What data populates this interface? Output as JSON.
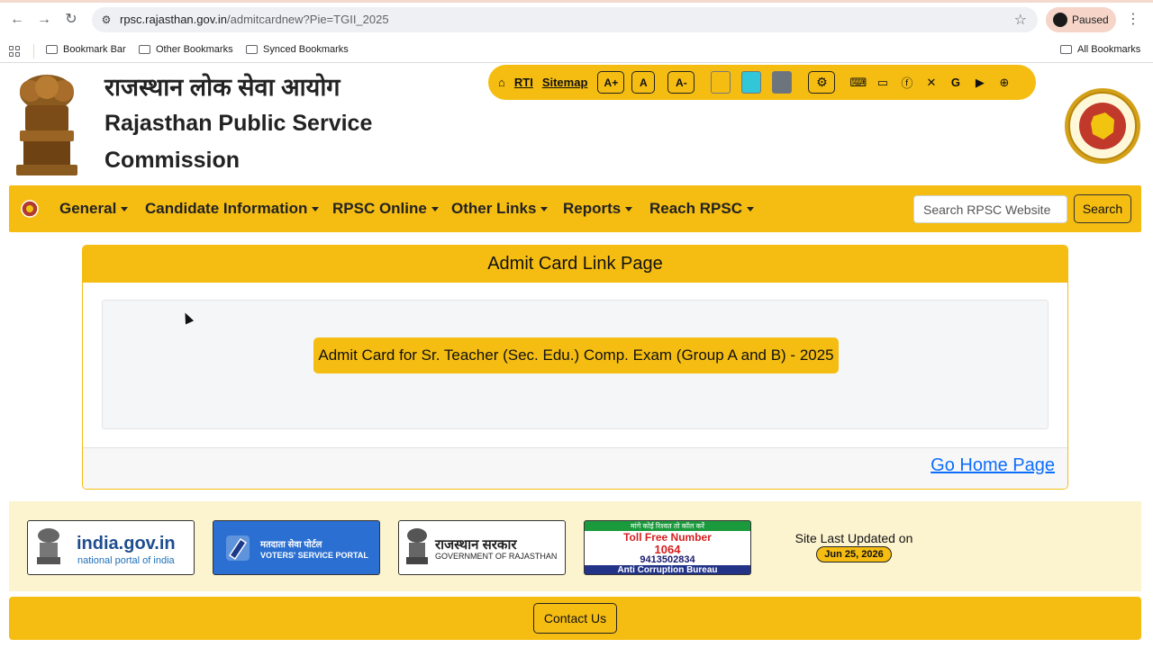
{
  "browser": {
    "url_host": "rpsc.rajasthan.gov.in",
    "url_path": "/admitcardnew?Pie=TGII_2025",
    "profile_status": "Paused",
    "bookmarks": [
      "Bookmark Bar",
      "Other Bookmarks",
      "Synced Bookmarks"
    ],
    "all_bookmarks": "All Bookmarks"
  },
  "header": {
    "title_hindi": "राजस्थान लोक सेवा आयोग",
    "title_english_line1": "Rajasthan Public Service",
    "title_english_line2": "Commission"
  },
  "topbar": {
    "rti": "RTI",
    "sitemap": "Sitemap",
    "font_plus": "A+",
    "font_normal": "A",
    "font_minus": "A-",
    "swatches": [
      "#f5bd12",
      "#31c6d8",
      "#6c757d"
    ]
  },
  "nav": {
    "items": [
      "General",
      "Candidate Information",
      "RPSC Online",
      "Other Links",
      "Reports",
      "Reach RPSC"
    ],
    "search_placeholder": "Search RPSC Website",
    "search_button": "Search"
  },
  "card": {
    "title": "Admit Card Link Page",
    "admit_link": "Admit Card for Sr. Teacher (Sec. Edu.) Comp. Exam (Group A and B) - 2025",
    "go_home": "Go Home Page"
  },
  "footer": {
    "india_gov_big": "india.gov.in",
    "india_gov_small": "national portal of india",
    "voters_hi": "मतदाता सेवा पोर्टल",
    "voters_en": "VOTERS' SERVICE PORTAL",
    "raj_hi": "राजस्थान सरकार",
    "raj_en": "GOVERNMENT OF RAJASTHAN",
    "acb_top": "मांगे कोई रिश्वत तो कॉल करें",
    "acb_toll": "Toll Free Number",
    "acb_num": "1064",
    "acb_phone": "9413502834",
    "acb_name": "Anti Corruption Bureau",
    "updated_label": "Site Last Updated on",
    "updated_date": "Jun 25, 2026",
    "contact": "Contact Us"
  },
  "colors": {
    "accent": "#f5bd12",
    "link": "#0d6efd"
  }
}
